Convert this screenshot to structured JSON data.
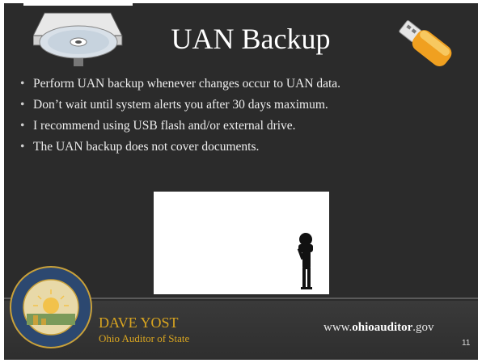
{
  "slide": {
    "title": "UAN Backup",
    "title_tail_glyph": "UAN",
    "bullets": [
      "Perform UAN backup whenever changes occur to UAN data.",
      "Don’t wait until system alerts you after 30 days maximum.",
      "I recommend using USB flash and/or external drive.",
      "The UAN backup does not cover documents."
    ],
    "bullet_symbol": "•",
    "page_number": "11"
  },
  "footer": {
    "name": "DAVE YOST",
    "role": "Ohio Auditor of State",
    "website_prefix": "www.",
    "website_domain": "ohioauditor",
    "website_suffix": ".gov",
    "seal_text": "THE SEAL OF THE AUDITOR OF STATE OF OHIO"
  },
  "icons": {
    "cd_drive": "cd-drive-icon",
    "usb": "usb-flash-drive-icon",
    "figure": "standing-figure-icon",
    "seal": "ohio-auditor-seal-icon"
  },
  "colors": {
    "background": "#2b2b2b",
    "accent_gold": "#d9a520",
    "usb_orange": "#f0a020"
  }
}
